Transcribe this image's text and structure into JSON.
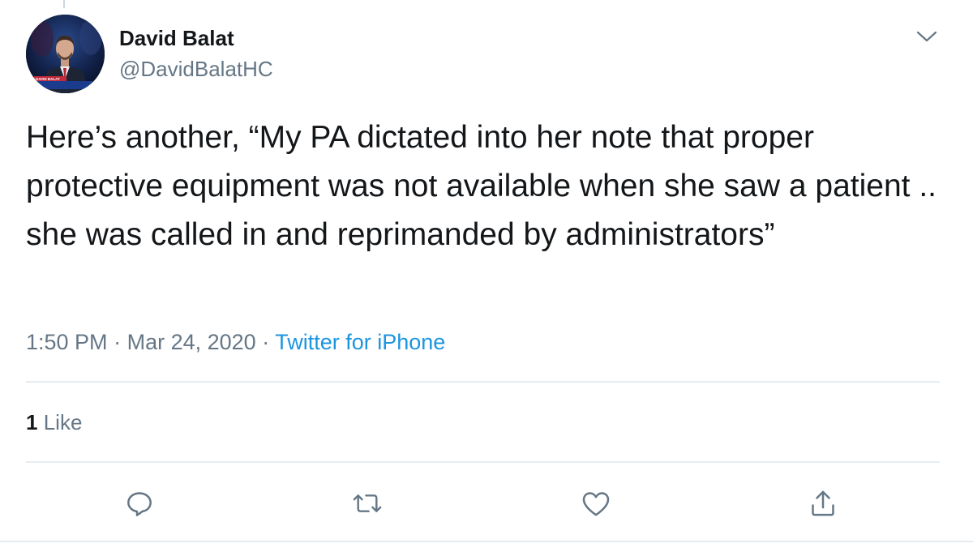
{
  "tweet": {
    "author": {
      "name": "David Balat",
      "handle": "@DavidBalatHC",
      "avatar_banner_text": "DAVID BALAT"
    },
    "text": "Here’s another, “My PA dictated into her note that proper protective equipment was not available when she saw a patient .. she was called in and reprimanded by administrators”",
    "time": "1:50 PM",
    "separator": "·",
    "date": "Mar 24, 2020",
    "source": "Twitter for iPhone",
    "stats": {
      "likes_count": "1",
      "likes_label": "Like"
    }
  },
  "icons": {
    "caret": "chevron-down-icon",
    "reply": "reply-icon",
    "retweet": "retweet-icon",
    "like": "heart-icon",
    "share": "share-icon"
  },
  "colors": {
    "text": "#14171a",
    "secondary": "#657786",
    "link": "#1b95e0",
    "divider": "#e6ecf0"
  }
}
